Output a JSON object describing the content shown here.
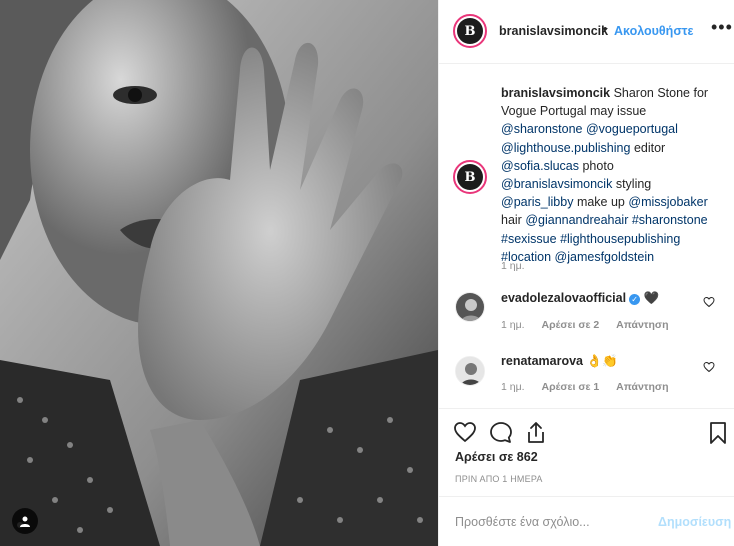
{
  "header": {
    "username": "branislavsimoncik",
    "separator": "•",
    "follow_label": "Ακολουθήστε",
    "more_label": "•••",
    "avatar_letter": "B"
  },
  "caption": {
    "username": "branislavsimoncik",
    "text_1": "Sharon Stone for Vogue Portugal may issue",
    "mention_1": "@sharonstone",
    "mention_2": "@vogueportugal",
    "mention_3": "@lighthouse.publishing",
    "text_2": "editor",
    "mention_4": "@sofia.slucas",
    "text_3": "photo",
    "mention_5": "@branislavsimoncik",
    "text_4": "styling",
    "mention_6": "@paris_libby",
    "text_5": "make up",
    "mention_7": "@missjobaker",
    "text_6": "hair",
    "mention_8": "@giannandreahair",
    "tag_1": "#sharonstone",
    "tag_2": "#sexissue",
    "tag_3": "#lighthousepublishing",
    "tag_4": "#location",
    "mention_9": "@jamesfgoldstein",
    "time": "1 ημ."
  },
  "comments": [
    {
      "username": "evadolezalovaofficial",
      "text": "🖤",
      "time": "1 ημ.",
      "likes": "Αρέσει σε 2",
      "reply": "Απάντηση"
    },
    {
      "username": "renatamarova",
      "text": "👌👏",
      "time": "1 ημ.",
      "likes": "Αρέσει σε 1",
      "reply": "Απάντηση"
    }
  ],
  "likes_label": "Αρέσει σε 862",
  "date_label": "ΠΡΙΝ ΑΠΟ 1 ΗΜΕΡΑ",
  "add_comment": {
    "placeholder": "Προσθέστε ένα σχόλιο...",
    "post_label": "Δημοσίευση"
  },
  "colors": {
    "accent": "#3897f0",
    "mention": "#003569",
    "muted": "#8e8e8e",
    "story_ring": "#e9367a"
  }
}
